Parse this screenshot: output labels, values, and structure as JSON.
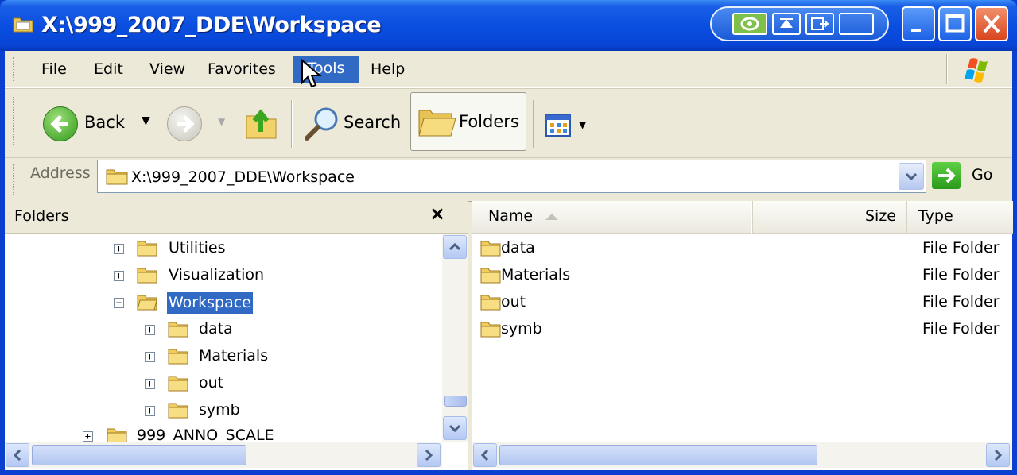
{
  "window": {
    "title": "X:\\999_2007_DDE\\Workspace"
  },
  "menubar": {
    "items": [
      "File",
      "Edit",
      "View",
      "Favorites",
      "Tools",
      "Help"
    ],
    "active_index": 4
  },
  "toolbar": {
    "back_label": "Back",
    "search_label": "Search",
    "folders_label": "Folders"
  },
  "address": {
    "label": "Address",
    "value": "X:\\999_2007_DDE\\Workspace",
    "go_label": "Go"
  },
  "folders_pane": {
    "title": "Folders",
    "close_glyph": "×",
    "tree": [
      {
        "label": "Utilities",
        "expander": "+",
        "selected": false
      },
      {
        "label": "Visualization",
        "expander": "+",
        "selected": false
      },
      {
        "label": "Workspace",
        "expander": "−",
        "selected": true
      },
      {
        "label": "data",
        "expander": "+",
        "selected": false
      },
      {
        "label": "Materials",
        "expander": "+",
        "selected": false
      },
      {
        "label": "out",
        "expander": "+",
        "selected": false
      },
      {
        "label": "symb",
        "expander": "+",
        "selected": false
      },
      {
        "label": "999_ANNO_SCALE",
        "expander": "+",
        "selected": false
      }
    ]
  },
  "file_list": {
    "columns": {
      "name": "Name",
      "size": "Size",
      "type": "Type"
    },
    "items": [
      {
        "name": "data",
        "type": "File Folder"
      },
      {
        "name": "Materials",
        "type": "File Folder"
      },
      {
        "name": "out",
        "type": "File Folder"
      },
      {
        "name": "symb",
        "type": "File Folder"
      }
    ]
  },
  "colors": {
    "title_blue": "#0a4fe0",
    "selection": "#316ac5",
    "chrome": "#ece9d8"
  }
}
